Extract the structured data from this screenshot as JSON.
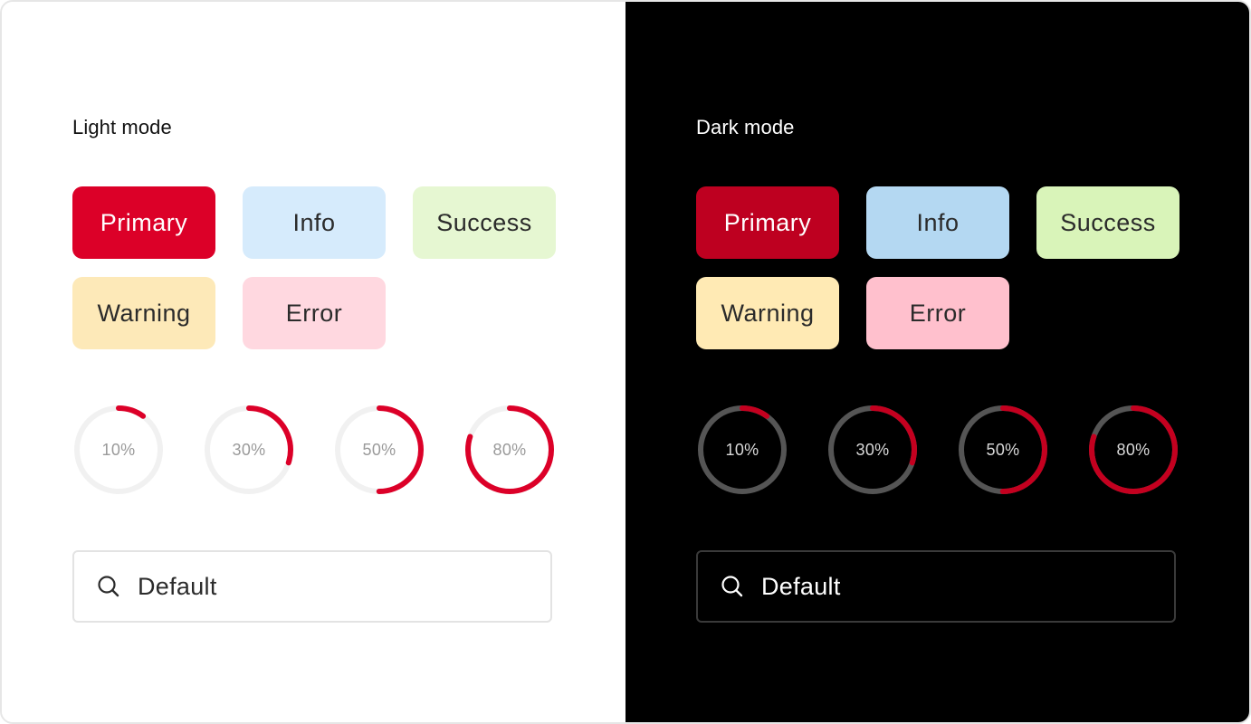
{
  "panels": [
    {
      "id": "light",
      "title": "Light mode",
      "buttons": [
        {
          "label": "Primary",
          "bg": "#dc0028",
          "fg": "#ffffff"
        },
        {
          "label": "Info",
          "bg": "#d6ebfc",
          "fg": "#2b2b2b"
        },
        {
          "label": "Success",
          "bg": "#e6f7d2",
          "fg": "#2b2b2b"
        },
        {
          "label": "Warning",
          "bg": "#fde9b8",
          "fg": "#2b2b2b"
        },
        {
          "label": "Error",
          "bg": "#ffd8e0",
          "fg": "#2b2b2b"
        }
      ],
      "progress": [
        {
          "label": "10%",
          "value": 0.1
        },
        {
          "label": "30%",
          "value": 0.3
        },
        {
          "label": "50%",
          "value": 0.5
        },
        {
          "label": "80%",
          "value": 0.8
        }
      ],
      "ring_colors": {
        "track": "#f1f1f1",
        "fill": "#dc0028"
      },
      "search": {
        "value": "Default",
        "icon": "search-icon",
        "icon_color": "#2b2b2b"
      }
    },
    {
      "id": "dark",
      "title": "Dark mode",
      "buttons": [
        {
          "label": "Primary",
          "bg": "#be0020",
          "fg": "#ffffff"
        },
        {
          "label": "Info",
          "bg": "#b4d8f2",
          "fg": "#2b2b2b"
        },
        {
          "label": "Success",
          "bg": "#d9f4b9",
          "fg": "#2b2b2b"
        },
        {
          "label": "Warning",
          "bg": "#ffeab4",
          "fg": "#2b2b2b"
        },
        {
          "label": "Error",
          "bg": "#ffc0cd",
          "fg": "#2b2b2b"
        }
      ],
      "progress": [
        {
          "label": "10%",
          "value": 0.1
        },
        {
          "label": "30%",
          "value": 0.3
        },
        {
          "label": "50%",
          "value": 0.5
        },
        {
          "label": "80%",
          "value": 0.8
        }
      ],
      "ring_colors": {
        "track": "#555555",
        "fill": "#c4001f"
      },
      "search": {
        "value": "Default",
        "icon": "search-icon",
        "icon_color": "#ffffff"
      }
    }
  ]
}
